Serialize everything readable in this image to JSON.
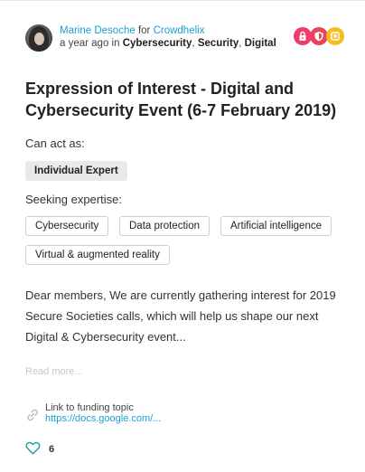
{
  "post": {
    "author": "Marine Desoche",
    "for_word": "for",
    "organization": "Crowdhelix",
    "time": "a year ago in",
    "categories": [
      "Cybersecurity",
      "Security",
      "Digital"
    ],
    "separator": ",",
    "title": "Expression of Interest - Digital and Cybersecurity Event (6-7 February 2019)"
  },
  "badges": [
    {
      "icon": "lock-icon",
      "color": "#ef3c6b"
    },
    {
      "icon": "shield-icon",
      "color": "#e8455c"
    },
    {
      "icon": "box-icon",
      "color": "#f5bd22"
    }
  ],
  "roles": {
    "label": "Can act as:",
    "items": [
      "Individual Expert"
    ]
  },
  "expertise": {
    "label": "Seeking expertise:",
    "items": [
      "Cybersecurity",
      "Data protection",
      "Artificial intelligence",
      "Virtual & augmented reality"
    ]
  },
  "description": "Dear members, We are currently gathering interest for 2019 Secure Societies calls, which will help us shape our next Digital & Cybersecurity event...",
  "read_more": "Read more...",
  "link": {
    "label": "Link to funding topic",
    "url": "https://docs.google.com/..."
  },
  "likes": {
    "count": "6"
  }
}
